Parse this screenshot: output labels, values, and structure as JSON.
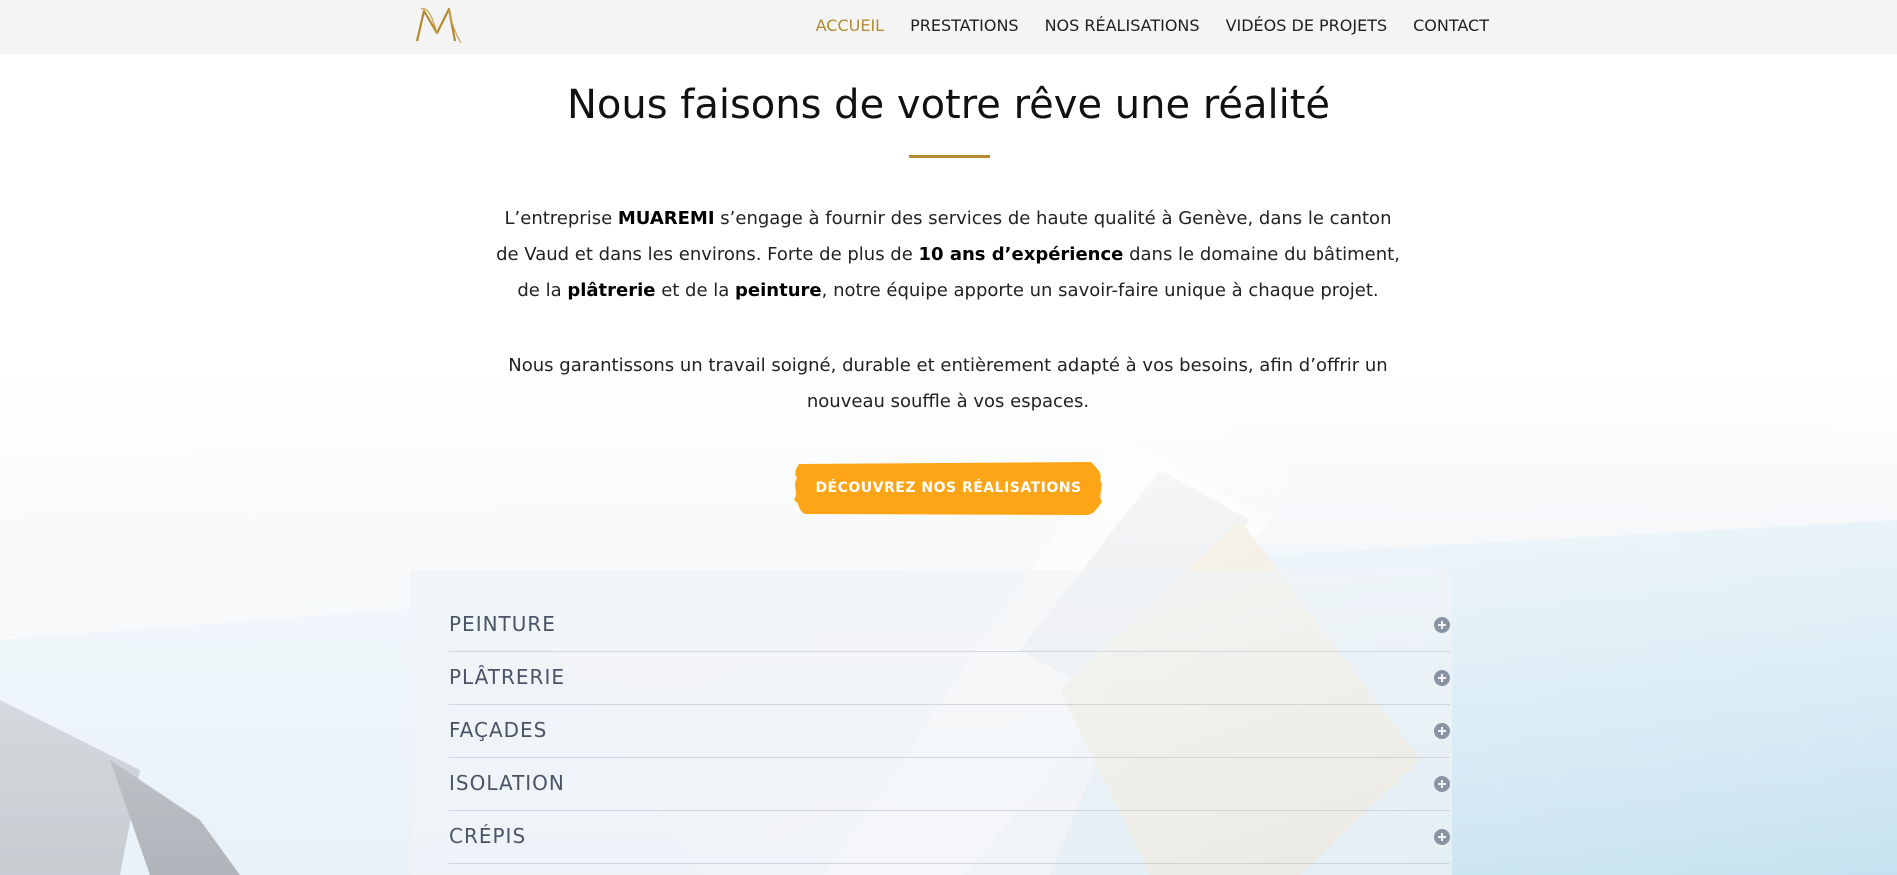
{
  "header": {
    "logo_icon": "monogram-m-logo",
    "nav": [
      {
        "label": "ACCUEIL",
        "active": true
      },
      {
        "label": "PRESTATIONS",
        "active": false
      },
      {
        "label": "NOS RÉALISATIONS",
        "active": false
      },
      {
        "label": "VIDÉOS DE PROJETS",
        "active": false
      },
      {
        "label": "CONTACT",
        "active": false
      }
    ]
  },
  "hero": {
    "title": "Nous faisons de votre rêve une réalité",
    "intro": {
      "t1": "L’entreprise ",
      "b1": "MUAREMI",
      "t2": " s’engage à fournir des services de haute qualité à Genève, dans le canton de Vaud et dans les environs. Forte de plus de ",
      "b2": "10 ans d’expérience",
      "t3": " dans le domaine du bâtiment, de la ",
      "b3": "plâtrerie",
      "t4": " et de la ",
      "b4": "peinture",
      "t5": ", notre équipe apporte un savoir-faire unique à chaque projet."
    },
    "paragraph2": "Nous garantissons un travail soigné, durable et entièrement adapté à vos besoins, afin d’offrir un nouveau souffle à vos espaces.",
    "cta_label": "DÉCOUVREZ NOS RÉALISATIONS"
  },
  "accordion": {
    "items": [
      {
        "label": "PEINTURE",
        "icon": "plus-circle-icon"
      },
      {
        "label": "PLÂTRERIE",
        "icon": "plus-circle-icon"
      },
      {
        "label": "FAÇADES",
        "icon": "plus-circle-icon"
      },
      {
        "label": "ISOLATION",
        "icon": "plus-circle-icon"
      },
      {
        "label": "CRÉPIS",
        "icon": "plus-circle-icon"
      }
    ]
  },
  "colors": {
    "accent_gold": "#b48a2f",
    "cta_orange": "#fda516",
    "accordion_text": "#4a5466",
    "header_bg": "#f4f4f4"
  }
}
